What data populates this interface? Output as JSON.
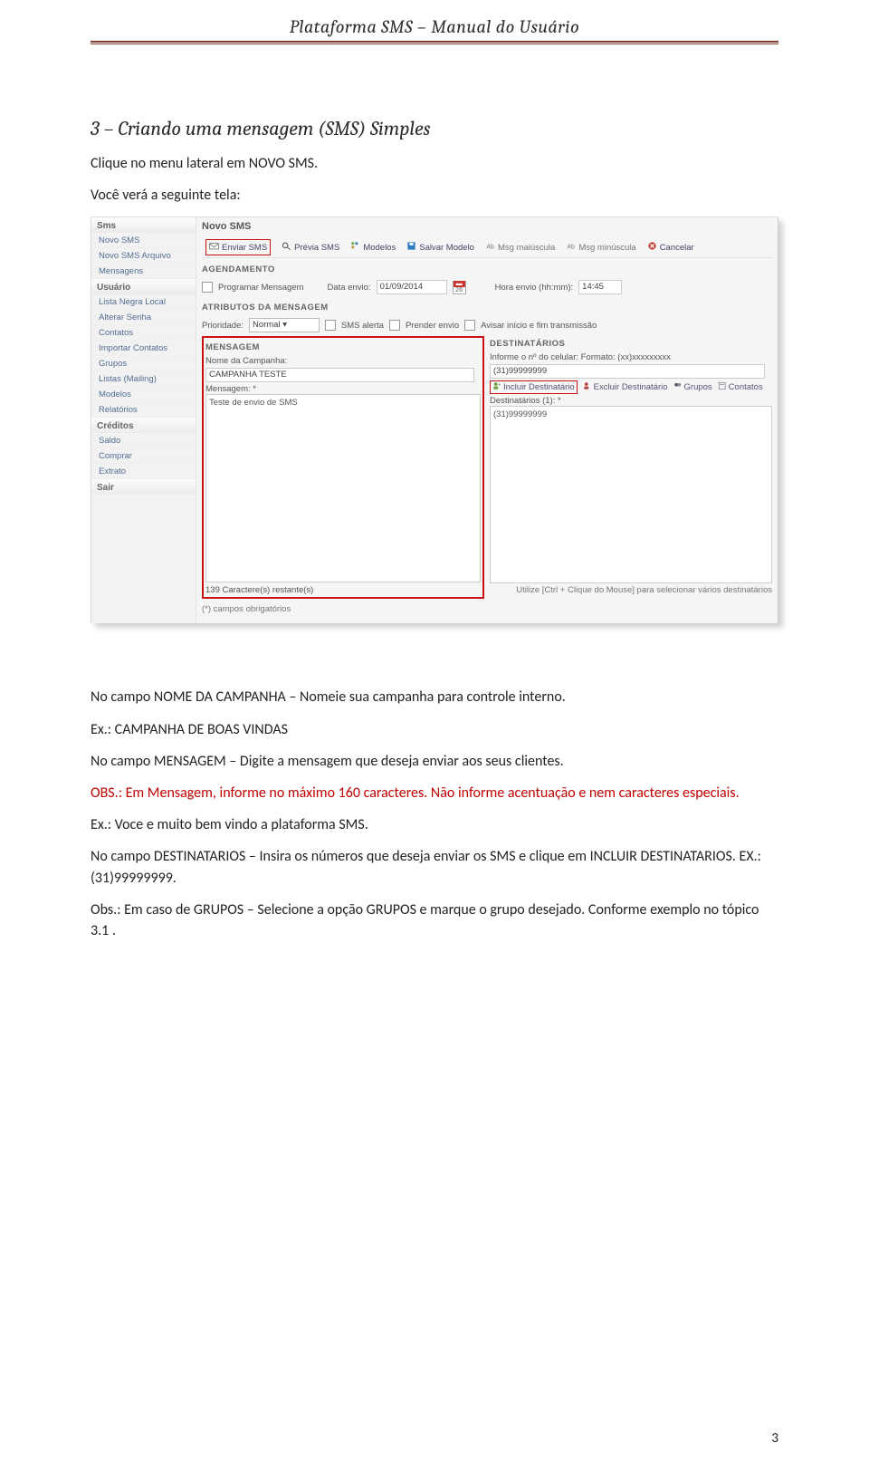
{
  "header": {
    "title": "Plataforma SMS – Manual do Usuário"
  },
  "section": {
    "title": "3 – Criando uma mensagem (SMS) Simples",
    "intro1": "Clique no menu lateral em NOVO SMS.",
    "intro2": "Você verá a seguinte tela:"
  },
  "screenshot": {
    "sidebar": {
      "groups": [
        {
          "title": "Sms",
          "items": [
            "Novo SMS",
            "Novo SMS Arquivo",
            "Mensagens"
          ]
        },
        {
          "title": "Usuário",
          "items": [
            "Lista Negra Local",
            "Alterar Senha",
            "Contatos",
            "Importar Contatos",
            "Grupos",
            "Listas (Mailing)",
            "Modelos",
            "Relatórios"
          ]
        },
        {
          "title": "Créditos",
          "items": [
            "Saldo",
            "Comprar",
            "Extrato"
          ]
        },
        {
          "title": "Sair",
          "items": []
        }
      ]
    },
    "panel_title": "Novo SMS",
    "toolbar": {
      "enviar": "Enviar SMS",
      "previa": "Prévia SMS",
      "modelos": "Modelos",
      "salvar": "Salvar Modelo",
      "maiuscula": "Msg maiúscula",
      "minuscula": "Msg minúscula",
      "cancelar": "Cancelar"
    },
    "agendamento": {
      "label": "AGENDAMENTO",
      "programar_label": "Programar Mensagem",
      "data_lbl": "Data envio:",
      "data_val": "01/09/2014",
      "cal_day": "26",
      "hora_lbl": "Hora envio (hh:mm):",
      "hora_val": "14:45"
    },
    "atributos": {
      "label": "ATRIBUTOS DA MENSAGEM",
      "prio_lbl": "Prioridade:",
      "prio_val": "Normal",
      "sms_alerta": "SMS alerta",
      "prender": "Prender envio",
      "avisar": "Avisar início e fim transmissão"
    },
    "mensagem": {
      "label": "MENSAGEM",
      "nome_lbl": "Nome da Campanha:",
      "nome_val": "CAMPANHA TESTE",
      "msg_lbl": "Mensagem: *",
      "msg_val": "Teste de envio de SMS",
      "restante": "139 Caractere(s) restante(s)"
    },
    "destinatarios": {
      "label": "DESTINATÁRIOS",
      "informe": "Informe o nº do celular: Formato: (xx)xxxxxxxxx",
      "cel_val": "(31)99999999",
      "incluir": "Incluir Destinatário",
      "excluir": "Excluir Destinatário",
      "grupos": "Grupos",
      "contatos": "Contatos",
      "list_lbl": "Destinatários (1): *",
      "list_val": "(31)99999999",
      "hint": "Utilize [Ctrl + Clique do Mouse] para selecionar vários destinatários"
    },
    "obrigatorio": "(*) campos obrigatórios"
  },
  "after": {
    "p1": "No campo NOME DA CAMPANHA – Nomeie sua campanha para controle interno.",
    "p2": "Ex.: CAMPANHA DE BOAS VINDAS",
    "p3": "No campo MENSAGEM – Digite a mensagem que deseja enviar aos seus clientes.",
    "p4": "OBS.: Em Mensagem, informe no máximo 160 caracteres. Não informe acentuação e nem caracteres especiais.",
    "p5": "Ex.: Voce e muito bem vindo a plataforma SMS.",
    "p6": "No campo DESTINATARIOS – Insira os números que deseja enviar os SMS e clique em INCLUIR DESTINATARIOS. EX.: (31)99999999.",
    "p7": "Obs.: Em caso de GRUPOS – Selecione a opção GRUPOS e marque o grupo desejado. Conforme exemplo no tópico 3.1 ."
  },
  "page_number": "3"
}
